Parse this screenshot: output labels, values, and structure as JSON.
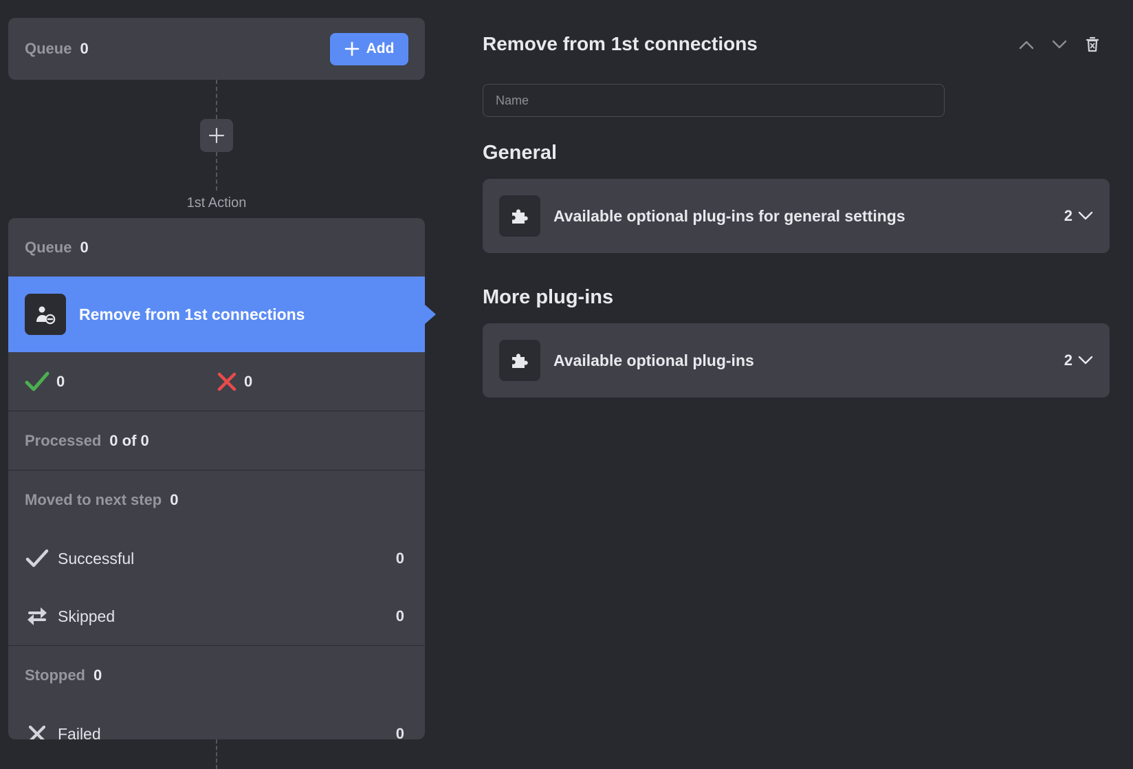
{
  "colors": {
    "background": "#28292e",
    "card": "#3f4048",
    "accent": "#5b8cf5",
    "success": "#4caf50",
    "error": "#e84b4b"
  },
  "top_queue": {
    "label": "Queue",
    "count": "0",
    "add_label": "Add",
    "add_icon": "plus-icon"
  },
  "insert_node": {
    "icon": "plus-icon"
  },
  "action": {
    "caption": "1st Action",
    "queue_label": "Queue",
    "queue_count": "0",
    "step_title": "Remove from 1st connections",
    "step_icon": "user-remove-icon",
    "success_count": "0",
    "error_count": "0",
    "processed_label": "Processed",
    "processed_value": "0 of 0",
    "moved_label": "Moved to next step",
    "moved_count": "0",
    "moved_items": [
      {
        "label": "Successful",
        "value": "0",
        "icon": "check-icon"
      },
      {
        "label": "Skipped",
        "value": "0",
        "icon": "swap-icon"
      }
    ],
    "stopped_label": "Stopped",
    "stopped_count": "0",
    "stopped_items": [
      {
        "label": "Failed",
        "value": "0",
        "icon": "x-icon"
      }
    ]
  },
  "details": {
    "title": "Remove from 1st connections",
    "name_placeholder": "Name",
    "actions": [
      "chevron-up-icon",
      "chevron-down-icon",
      "trash-icon"
    ],
    "general_heading": "General",
    "general_plugin_label": "Available optional plug-ins for general settings",
    "general_plugin_count": "2",
    "more_heading": "More plug-ins",
    "more_plugin_label": "Available optional plug-ins",
    "more_plugin_count": "2"
  }
}
